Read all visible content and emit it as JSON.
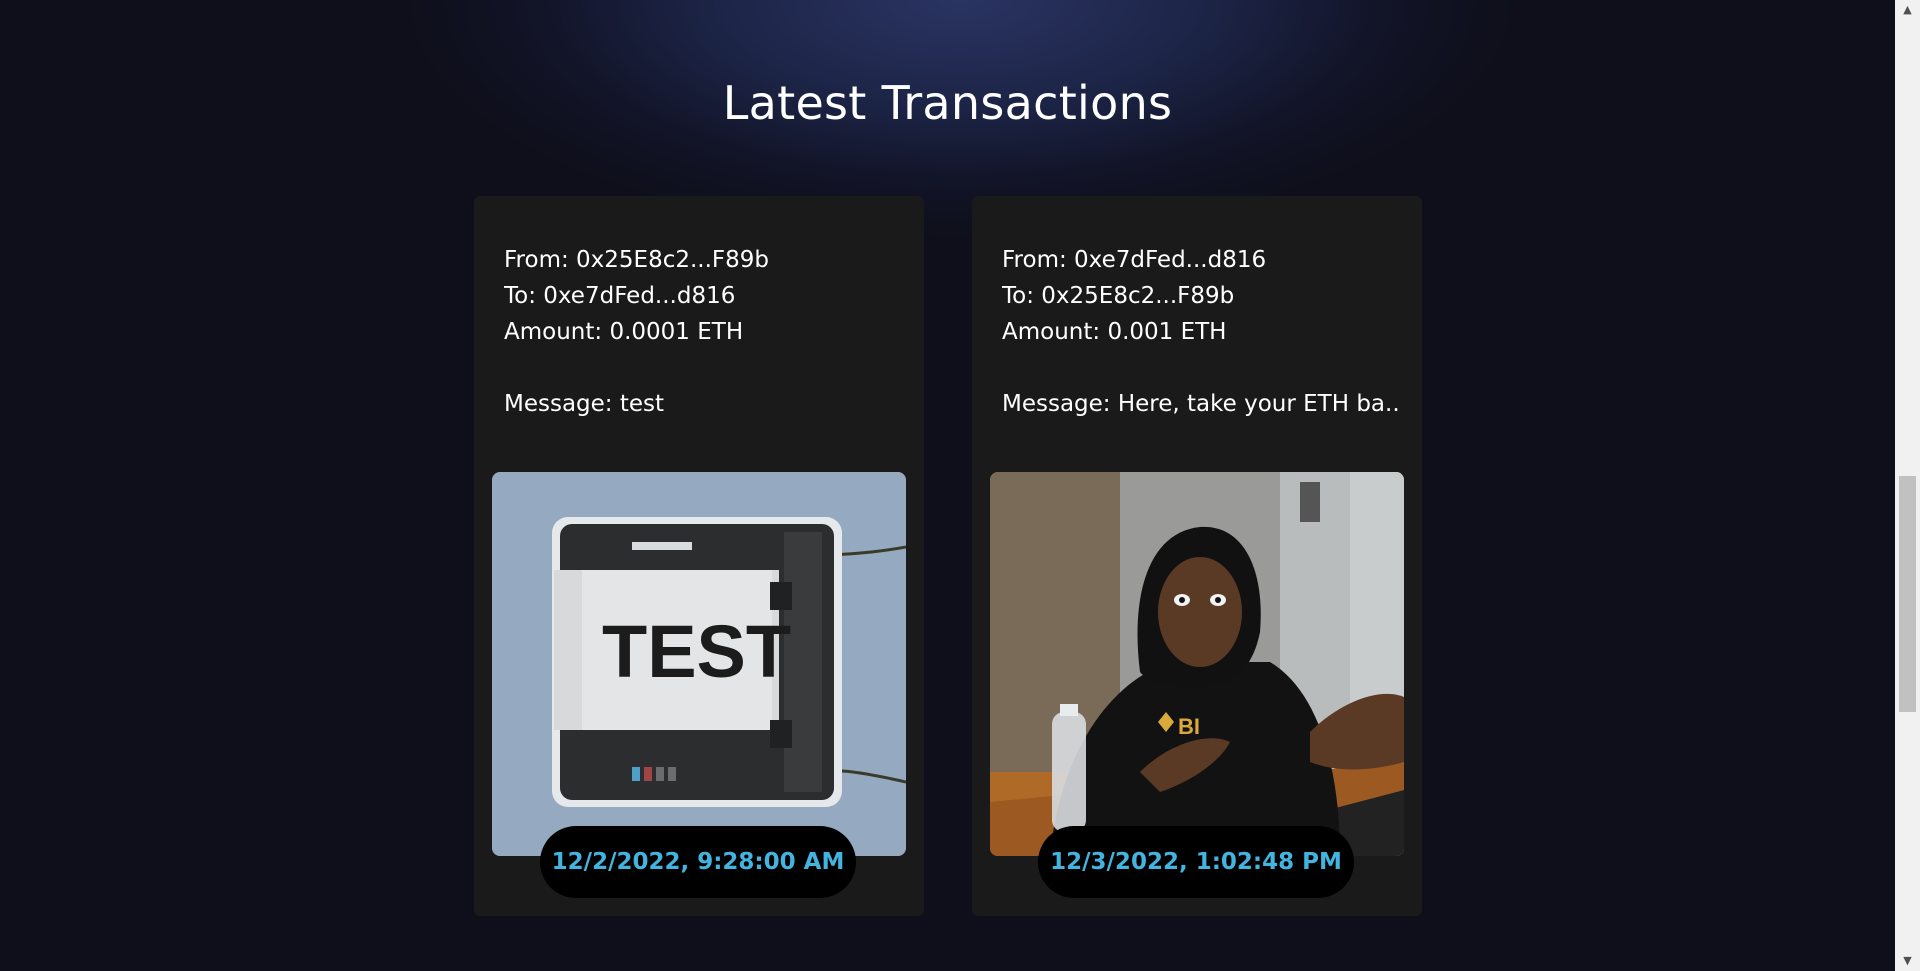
{
  "page": {
    "title": "Latest Transactions"
  },
  "transactions": [
    {
      "from": "From: 0x25E8c2...F89b",
      "to": "To: 0xe7dFed...d816",
      "amount": "Amount: 0.0001 ETH",
      "message": "Message: test",
      "timestamp": "12/2/2022, 9:28:00 AM",
      "gif_text": "TEST"
    },
    {
      "from": "From: 0xe7dFed...d816",
      "to": "To: 0x25E8c2...F89b",
      "amount": "Amount: 0.001 ETH",
      "message": "Message: Here, take your ETH ba...",
      "timestamp": "12/3/2022, 1:02:48 PM",
      "gif_text": "BI"
    }
  ],
  "colors": {
    "card_background": "#1a1a1b",
    "timestamp_text": "#43b3e0",
    "timestamp_pill": "#000000",
    "text": "#ffffff"
  }
}
